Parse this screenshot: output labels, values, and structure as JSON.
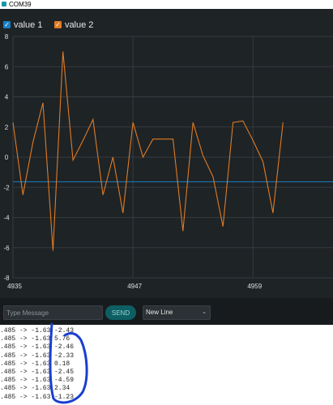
{
  "window": {
    "title": "COM39"
  },
  "legend": [
    {
      "label": "value 1",
      "color": "#1a80c4"
    },
    {
      "label": "value 2",
      "color": "#e07b23"
    }
  ],
  "chart_data": {
    "type": "line",
    "x_tick_labels": [
      "4935",
      "4947",
      "4959"
    ],
    "x_tick_values": [
      4935,
      4947,
      4959
    ],
    "xlim": [
      4935,
      4967
    ],
    "ylim": [
      -8,
      8
    ],
    "y_ticks": [
      8,
      6,
      4,
      2,
      0,
      -2,
      -4,
      -6,
      -8
    ],
    "grid": true,
    "legend_position": "top-left",
    "series": [
      {
        "name": "value 1",
        "color": "#1a80c4",
        "x": [
          4935,
          4967
        ],
        "y": [
          -1.63,
          -1.63
        ]
      },
      {
        "name": "value 2",
        "color": "#e07b23",
        "x": [
          4935,
          4936,
          4937,
          4938,
          4939,
          4940,
          4941,
          4942,
          4943,
          4944,
          4945,
          4946,
          4947,
          4948,
          4949,
          4950,
          4951,
          4952,
          4953,
          4954,
          4955,
          4956,
          4957,
          4958,
          4959,
          4960,
          4961,
          4962
        ],
        "y": [
          2.3,
          -2.5,
          1.0,
          3.6,
          -6.2,
          7.0,
          -0.2,
          1.1,
          2.5,
          -2.5,
          0.0,
          -3.7,
          2.3,
          0.0,
          1.2,
          1.2,
          1.2,
          -4.9,
          2.3,
          0.1,
          -1.3,
          -4.6,
          2.3,
          2.4,
          1.1,
          -0.3,
          -3.7,
          2.3
        ]
      }
    ]
  },
  "controls": {
    "message_placeholder": "Type Message",
    "send_label": "SEND",
    "line_ending": "New Line"
  },
  "console": {
    "lines": [
      {
        "left": ".485 -> -1.63",
        "right": "-2.43"
      },
      {
        "left": ".485 -> -1.63",
        "right": "5.76"
      },
      {
        "left": ".485 -> -1.63",
        "right": "-2.46"
      },
      {
        "left": ".485 -> -1.63",
        "right": "-2.33"
      },
      {
        "left": ".485 -> -1.63",
        "right": "0.18"
      },
      {
        "left": ".485 -> -1.63",
        "right": "-2.45"
      },
      {
        "left": ".485 -> -1.63",
        "right": "-4.59"
      },
      {
        "left": ".485 -> -1.63",
        "right": "2.34"
      },
      {
        "left": ".485 -> -1.63",
        "right": "-1.23"
      }
    ]
  }
}
